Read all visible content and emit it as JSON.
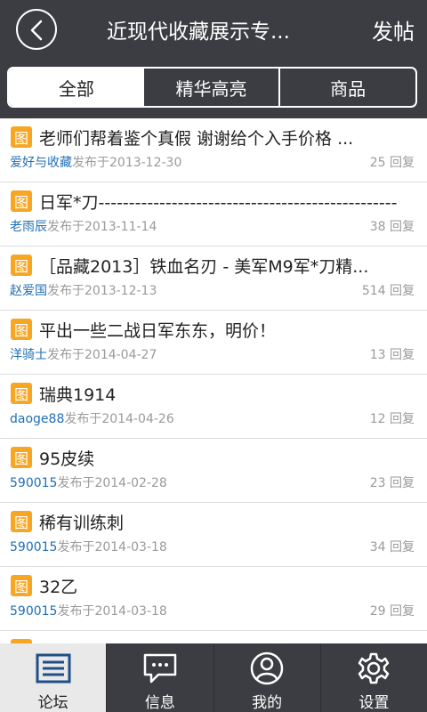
{
  "header": {
    "title": "近现代收藏展示专...",
    "post_label": "发帖",
    "back_icon": "chevron-left-icon"
  },
  "tabs": [
    {
      "label": "全部",
      "active": true
    },
    {
      "label": "精华高亮",
      "active": false
    },
    {
      "label": "商品",
      "active": false
    }
  ],
  "posts": [
    {
      "badge": "图",
      "title": "老师们帮着鉴个真假 谢谢给个入手价格 ...",
      "author": "爱好与收藏",
      "date": "发布于2013-12-30",
      "replies": "25 回复"
    },
    {
      "badge": "图",
      "title": "日军*刀--------------------------------------------------",
      "author": "老雨辰",
      "date": "发布于2013-11-14",
      "replies": "38 回复"
    },
    {
      "badge": "图",
      "title": "［品藏2013］铁血名刃 - 美军M9军*刀精...",
      "author": "赵爱国",
      "date": "发布于2013-12-13",
      "replies": "514 回复"
    },
    {
      "badge": "图",
      "title": "平出一些二战日军东东，明价！",
      "author": "洋骑士",
      "date": "发布于2014-04-27",
      "replies": "13 回复"
    },
    {
      "badge": "图",
      "title": "瑞典1914",
      "author": "daoge88",
      "date": "发布于2014-04-26",
      "replies": "12 回复"
    },
    {
      "badge": "图",
      "title": "95皮续",
      "author": "590015",
      "date": "发布于2014-02-28",
      "replies": "23 回复"
    },
    {
      "badge": "图",
      "title": "稀有训练刺",
      "author": "590015",
      "date": "发布于2014-03-18",
      "replies": "34 回复"
    },
    {
      "badge": "图",
      "title": "32乙",
      "author": "590015",
      "date": "发布于2014-03-18",
      "replies": "29 回复"
    }
  ],
  "nav": [
    {
      "label": "论坛",
      "icon": "forum-list-icon",
      "active": true
    },
    {
      "label": "信息",
      "icon": "message-bubble-icon",
      "active": false
    },
    {
      "label": "我的",
      "icon": "user-profile-icon",
      "active": false
    },
    {
      "label": "设置",
      "icon": "gear-icon",
      "active": false
    }
  ],
  "colors": {
    "header_bg": "#3b3d42",
    "badge": "#f6a623",
    "author": "#1f6fb4"
  }
}
